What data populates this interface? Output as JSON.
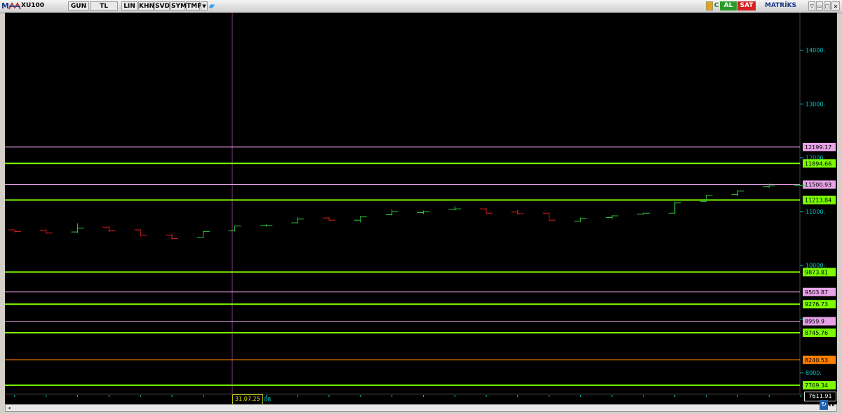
{
  "toolbar": {
    "app_letter": "M",
    "symbol": "XU100",
    "period": "GUN",
    "currency": "TL",
    "scale": "LIN",
    "buttons": [
      "KHN",
      "SVD",
      "SYM",
      "TMP"
    ],
    "buy_label": "AL",
    "sell_label": "SAT",
    "brand": "MATRİKS"
  },
  "colors": {
    "background": "#000000",
    "up": "#2ecc40",
    "down": "#e02020",
    "support_resistance_line": "#7CFC00",
    "fib_line": "#e7a3e7",
    "orange_line": "#ff7f00",
    "axis_text": "#00c8c8"
  },
  "chart_data": {
    "type": "ohlc",
    "title": "",
    "xlabel": "",
    "ylabel": "",
    "ylim": [
      7611.91,
      14700
    ],
    "y_ticks": [
      8000,
      9000,
      10000,
      11000,
      12000,
      13000,
      14000
    ],
    "y_tick_labels": [
      "8000.",
      "9000.",
      "10000.",
      "11000.",
      "12000.",
      "13000.",
      "14000."
    ],
    "crosshair_date": "31.07.25",
    "x_partial_label": "08",
    "current_value": "7611.91",
    "bars": [
      {
        "o": 10660,
        "h": 10660,
        "l": 10610,
        "c": 10630
      },
      {
        "o": 10650,
        "h": 10670,
        "l": 10590,
        "c": 10600
      },
      {
        "o": 10620,
        "h": 10780,
        "l": 10600,
        "c": 10690
      },
      {
        "o": 10710,
        "h": 10720,
        "l": 10620,
        "c": 10640
      },
      {
        "o": 10660,
        "h": 10670,
        "l": 10540,
        "c": 10560
      },
      {
        "o": 10560,
        "h": 10580,
        "l": 10480,
        "c": 10500
      },
      {
        "o": 10520,
        "h": 10640,
        "l": 10510,
        "c": 10630
      },
      {
        "o": 10640,
        "h": 10740,
        "l": 10630,
        "c": 10730
      },
      {
        "o": 10740,
        "h": 10760,
        "l": 10720,
        "c": 10740
      },
      {
        "o": 10790,
        "h": 10890,
        "l": 10780,
        "c": 10860
      },
      {
        "o": 10880,
        "h": 10890,
        "l": 10830,
        "c": 10840
      },
      {
        "o": 10840,
        "h": 10920,
        "l": 10800,
        "c": 10900
      },
      {
        "o": 10940,
        "h": 11040,
        "l": 10930,
        "c": 11000
      },
      {
        "o": 10980,
        "h": 11020,
        "l": 10950,
        "c": 11000
      },
      {
        "o": 11040,
        "h": 11100,
        "l": 11020,
        "c": 11050
      },
      {
        "o": 11050,
        "h": 11060,
        "l": 10950,
        "c": 10970
      },
      {
        "o": 10990,
        "h": 11030,
        "l": 10940,
        "c": 10960
      },
      {
        "o": 10970,
        "h": 10980,
        "l": 10830,
        "c": 10840
      },
      {
        "o": 10820,
        "h": 10890,
        "l": 10810,
        "c": 10870
      },
      {
        "o": 10890,
        "h": 10930,
        "l": 10860,
        "c": 10920
      },
      {
        "o": 10950,
        "h": 10980,
        "l": 10940,
        "c": 10970
      },
      {
        "o": 10970,
        "h": 11180,
        "l": 10960,
        "c": 11160
      },
      {
        "o": 11190,
        "h": 11310,
        "l": 11180,
        "c": 11300
      },
      {
        "o": 11320,
        "h": 11400,
        "l": 11290,
        "c": 11380
      },
      {
        "o": 11460,
        "h": 11520,
        "l": 11440,
        "c": 11480
      },
      {
        "o": 11490,
        "h": 11490,
        "l": 11490,
        "c": 11490
      }
    ],
    "levels": [
      {
        "value": 12199.17,
        "label": "12199.17",
        "kind": "fib"
      },
      {
        "value": 11894.66,
        "label": "11894.66",
        "kind": "green"
      },
      {
        "value": 11500.93,
        "label": "11500.93",
        "kind": "fib"
      },
      {
        "value": 11213.84,
        "label": "11213.84",
        "kind": "green"
      },
      {
        "value": 9873.81,
        "label": "9873.81",
        "kind": "green"
      },
      {
        "value": 9503.87,
        "label": "9503.87",
        "kind": "fib"
      },
      {
        "value": 9276.73,
        "label": "9276.73",
        "kind": "green"
      },
      {
        "value": 8959.9,
        "label": "8959.9",
        "kind": "fib"
      },
      {
        "value": 8745.76,
        "label": "8745.76",
        "kind": "green"
      },
      {
        "value": 8240.53,
        "label": "8240.53",
        "kind": "orange"
      },
      {
        "value": 7769.34,
        "label": "7769.34",
        "kind": "green"
      }
    ]
  }
}
